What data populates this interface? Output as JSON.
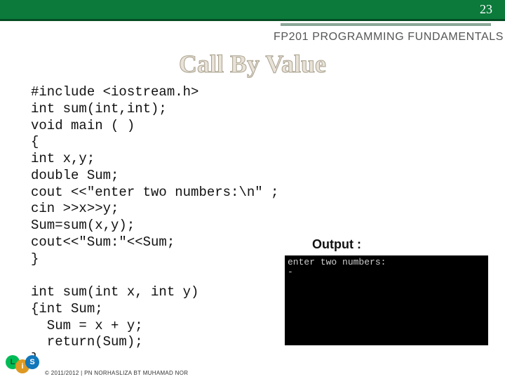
{
  "header": {
    "slide_number": "23",
    "course": "FP201 PROGRAMMING FUNDAMENTALS"
  },
  "title": "Call By Value",
  "code": "#include <iostream.h>\nint sum(int,int);\nvoid main ( )\n{\nint x,y;\ndouble Sum;\ncout <<\"enter two numbers:\\n\" ;\ncin >>x>>y;\nSum=sum(x,y);\ncout<<\"Sum:\"<<Sum;\n}\n\nint sum(int x, int y)\n{int Sum;\n  Sum = x + y;\n  return(Sum);\n}",
  "output": {
    "label": "Output :",
    "console": "enter two numbers:\n-"
  },
  "footer": {
    "logo_letters": {
      "a": "L",
      "b": "i",
      "c": "S"
    },
    "copyright": "© 2011/2012 | PN NORHASLIZA BT MUHAMAD NOR"
  }
}
